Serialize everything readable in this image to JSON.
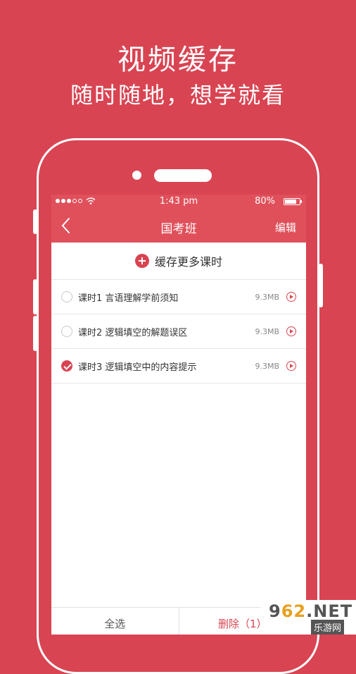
{
  "promo": {
    "title": "视频缓存",
    "subtitle": "随时随地，想学就看"
  },
  "statusbar": {
    "time": "1:43 pm",
    "battery": "80%",
    "battery_level": 0.8,
    "signal_dots": 3
  },
  "navbar": {
    "title": "国考班",
    "edit": "编辑"
  },
  "cache_more": {
    "label": "缓存更多课时"
  },
  "lessons": [
    {
      "name": "课时1  言语理解学前须知",
      "size": "9.3MB",
      "checked": false
    },
    {
      "name": "课时2  逻辑填空的解题误区",
      "size": "9.3MB",
      "checked": false
    },
    {
      "name": "课时3  逻辑填空中的内容提示",
      "size": "9.3MB",
      "checked": true
    }
  ],
  "bottombar": {
    "select_all": "全选",
    "delete": "删除（1）"
  },
  "watermark": {
    "brand_prefix": "9",
    "brand_num": "62",
    "brand_suffix": ".NET",
    "sub": "乐游网"
  },
  "colors": {
    "accent": "#d94452",
    "bar": "#e0505b"
  }
}
